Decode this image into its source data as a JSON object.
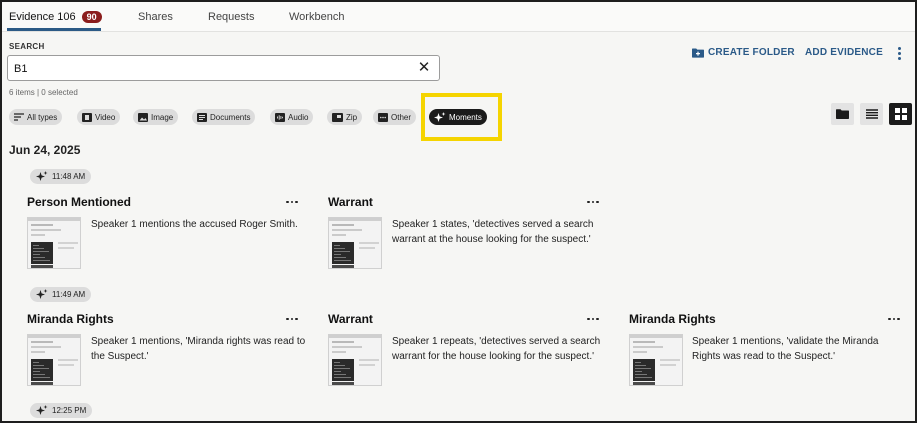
{
  "tabs": [
    {
      "label": "Evidence 106",
      "badge": "90"
    },
    {
      "label": "Shares"
    },
    {
      "label": "Requests"
    },
    {
      "label": "Workbench"
    }
  ],
  "search": {
    "label": "SEARCH",
    "value": "B1",
    "clear_icon": "close-icon"
  },
  "status": {
    "items_text": "6 items | 0 selected"
  },
  "actions": {
    "create_folder": "CREATE FOLDER",
    "add_evidence": "ADD EVIDENCE"
  },
  "filters": [
    {
      "label": "All types",
      "icon": "sort-lines-icon"
    },
    {
      "label": "Video",
      "icon": "film-icon"
    },
    {
      "label": "Image",
      "icon": "image-icon"
    },
    {
      "label": "Documents",
      "icon": "document-icon"
    },
    {
      "label": "Audio",
      "icon": "audio-icon"
    },
    {
      "label": "Zip",
      "icon": "zip-icon"
    },
    {
      "label": "Other",
      "icon": "more-box-icon"
    },
    {
      "label": "Moments",
      "icon": "sparkle-icon",
      "active": true
    }
  ],
  "colors": {
    "accent": "#2b5a88",
    "badge": "#8b1d1d",
    "highlight": "#f5d400",
    "chip_active": "#1b1b1b"
  },
  "date_heading": "Jun 24, 2025",
  "groups": [
    {
      "time": "11:48 AM",
      "moments": [
        {
          "title": "Person Mentioned",
          "desc": "Speaker 1 mentions the accused Roger Smith."
        },
        {
          "title": "Warrant",
          "desc": "Speaker 1 states, 'detectives served a search warrant at the house looking for the suspect.'"
        }
      ]
    },
    {
      "time": "11:49 AM",
      "moments": [
        {
          "title": "Miranda Rights",
          "desc": "Speaker 1 mentions, 'Miranda rights was read to the Suspect.'"
        },
        {
          "title": "Warrant",
          "desc": "Speaker 1 repeats, 'detectives served a search warrant for the house looking for the suspect.'"
        },
        {
          "title": "Miranda Rights",
          "desc": "Speaker 1 mentions, 'validate the Miranda Rights was read to the Suspect.'"
        }
      ]
    },
    {
      "time": "12:25 PM",
      "moments": []
    }
  ]
}
